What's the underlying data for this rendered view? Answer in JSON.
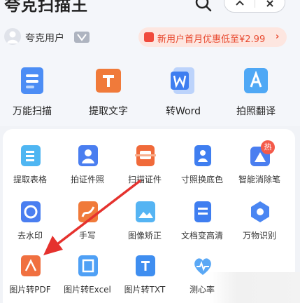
{
  "header": {
    "app_title": "夸克扫描王",
    "user_name": "夸克用户",
    "promo_text": "新用户首月优惠低至¥2.99",
    "promo_arrow": "›"
  },
  "top_tools": [
    {
      "label": "万能扫描",
      "icon": "scan-doc-icon",
      "color": "#4c8df5"
    },
    {
      "label": "提取文字",
      "icon": "text-extract-icon",
      "color": "#f07a3a"
    },
    {
      "label": "转Word",
      "icon": "word-icon",
      "color": "#3f7ef0"
    },
    {
      "label": "拍照翻译",
      "icon": "translate-icon",
      "color": "#4fa8f5"
    }
  ],
  "grid_tools": [
    {
      "label": "提取表格",
      "icon": "table-icon",
      "color": "#4fb6f2"
    },
    {
      "label": "拍证件照",
      "icon": "id-photo-icon",
      "color": "#4a7ef0"
    },
    {
      "label": "扫描证件",
      "icon": "id-scan-icon",
      "color": "#f06a3a"
    },
    {
      "label": "寸照换底色",
      "icon": "bg-change-icon",
      "color": "#3f7ef0"
    },
    {
      "label": "智能消除笔",
      "icon": "eraser-icon",
      "color": "#4a7ef0",
      "badge": "热"
    },
    {
      "label": "去水印",
      "icon": "watermark-icon",
      "color": "#4a7ef0"
    },
    {
      "label": "手写",
      "icon": "handwriting-icon",
      "color": "#f07a3a"
    },
    {
      "label": "图像矫正",
      "icon": "image-correct-icon",
      "color": "#55b4f3"
    },
    {
      "label": "文档变高清",
      "icon": "hd-doc-icon",
      "color": "#3f7ef0"
    },
    {
      "label": "万物识别",
      "icon": "recognize-icon",
      "color": "#4a86f2"
    },
    {
      "label": "图片转PDF",
      "icon": "pdf-icon",
      "color": "#f07040"
    },
    {
      "label": "图片转Excel",
      "icon": "excel-icon",
      "color": "#4fa0f5"
    },
    {
      "label": "图片转TXT",
      "icon": "txt-icon",
      "color": "#3f8ef0"
    },
    {
      "label": "测心率",
      "icon": "heart-rate-icon",
      "color": "#5aa8f5"
    }
  ],
  "colors": {
    "accent_red": "#e84a30",
    "annotation_arrow": "#e5322e"
  }
}
